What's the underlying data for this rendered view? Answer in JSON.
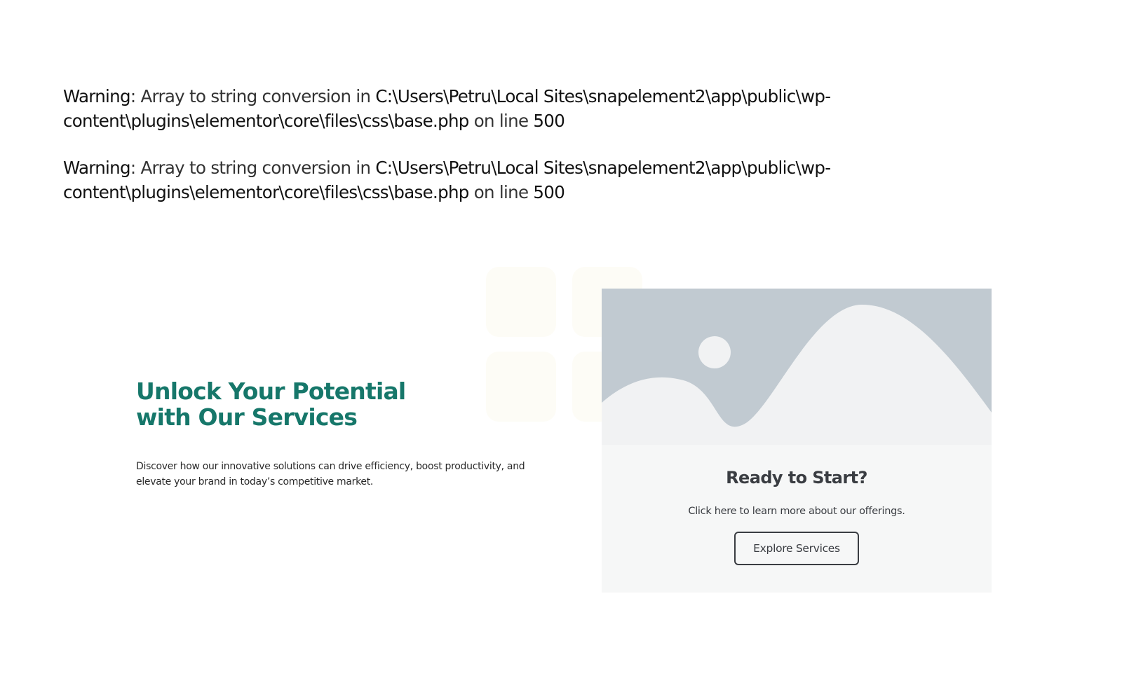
{
  "warnings": [
    {
      "label": "Warning",
      "message": ": Array to string conversion in ",
      "path": "C:\\Users\\Petru\\Local Sites\\snapelement2\\app\\public\\wp-content\\plugins\\elementor\\core\\files\\css\\base.php",
      "line_text": " on line ",
      "line": "500"
    },
    {
      "label": "Warning",
      "message": ": Array to string conversion in ",
      "path": "C:\\Users\\Petru\\Local Sites\\snapelement2\\app\\public\\wp-content\\plugins\\elementor\\core\\files\\css\\base.php",
      "line_text": " on line ",
      "line": "500"
    }
  ],
  "hero": {
    "title": "Unlock Your Potential with Our Services",
    "text": "Discover how our innovative solutions can drive efficiency, boost productivity, and elevate your brand in today’s competitive market."
  },
  "card": {
    "title": "Ready to Start?",
    "text": "Click here to learn more about our offerings.",
    "button_label": "Explore Services",
    "image_icon": "placeholder-image-icon"
  },
  "colors": {
    "accent": "#16776a",
    "card_bg": "#f6f7f7",
    "placeholder_sky": "#c1cad1",
    "placeholder_hill": "#f1f2f3",
    "text_dark": "#3a3d42"
  }
}
